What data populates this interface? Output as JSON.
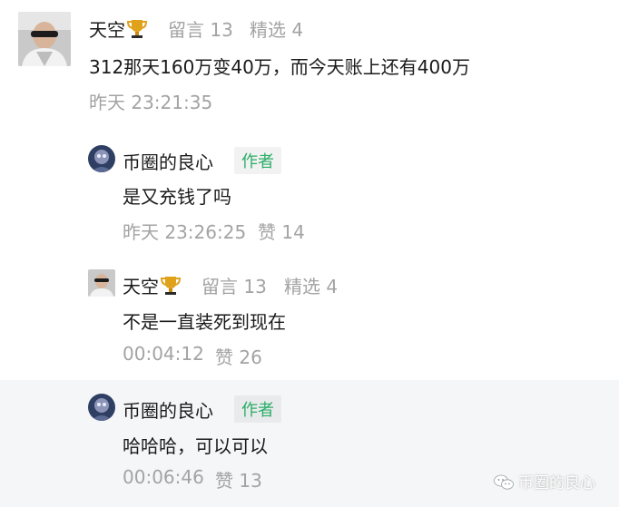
{
  "comments": [
    {
      "author": "天空",
      "messages_label": "留言 13",
      "featured_label": "精选 4",
      "content": "312那天160万变40万，而今天账上还有400万",
      "time": "昨天 23:21:35"
    }
  ],
  "replies": [
    {
      "author": "币圈的良心",
      "badge": "作者",
      "content": "是又充钱了吗",
      "time": "昨天 23:26:25",
      "likes_label": "赞 14"
    },
    {
      "author": "天空",
      "messages_label": "留言 13",
      "featured_label": "精选 4",
      "content": "不是一直装死到现在",
      "time": "00:04:12",
      "likes_label": "赞 26"
    },
    {
      "author": "币圈的良心",
      "badge": "作者",
      "content": "哈哈哈，可以可以",
      "time": "00:06:46",
      "likes_label": "赞 13"
    }
  ],
  "watermark": {
    "text": "币圈的良心",
    "icon": "wechat-icon"
  },
  "colors": {
    "meta_gray": "#a3a3a3",
    "author_green": "#2aae67",
    "highlight_bg": "#f5f6f7"
  }
}
